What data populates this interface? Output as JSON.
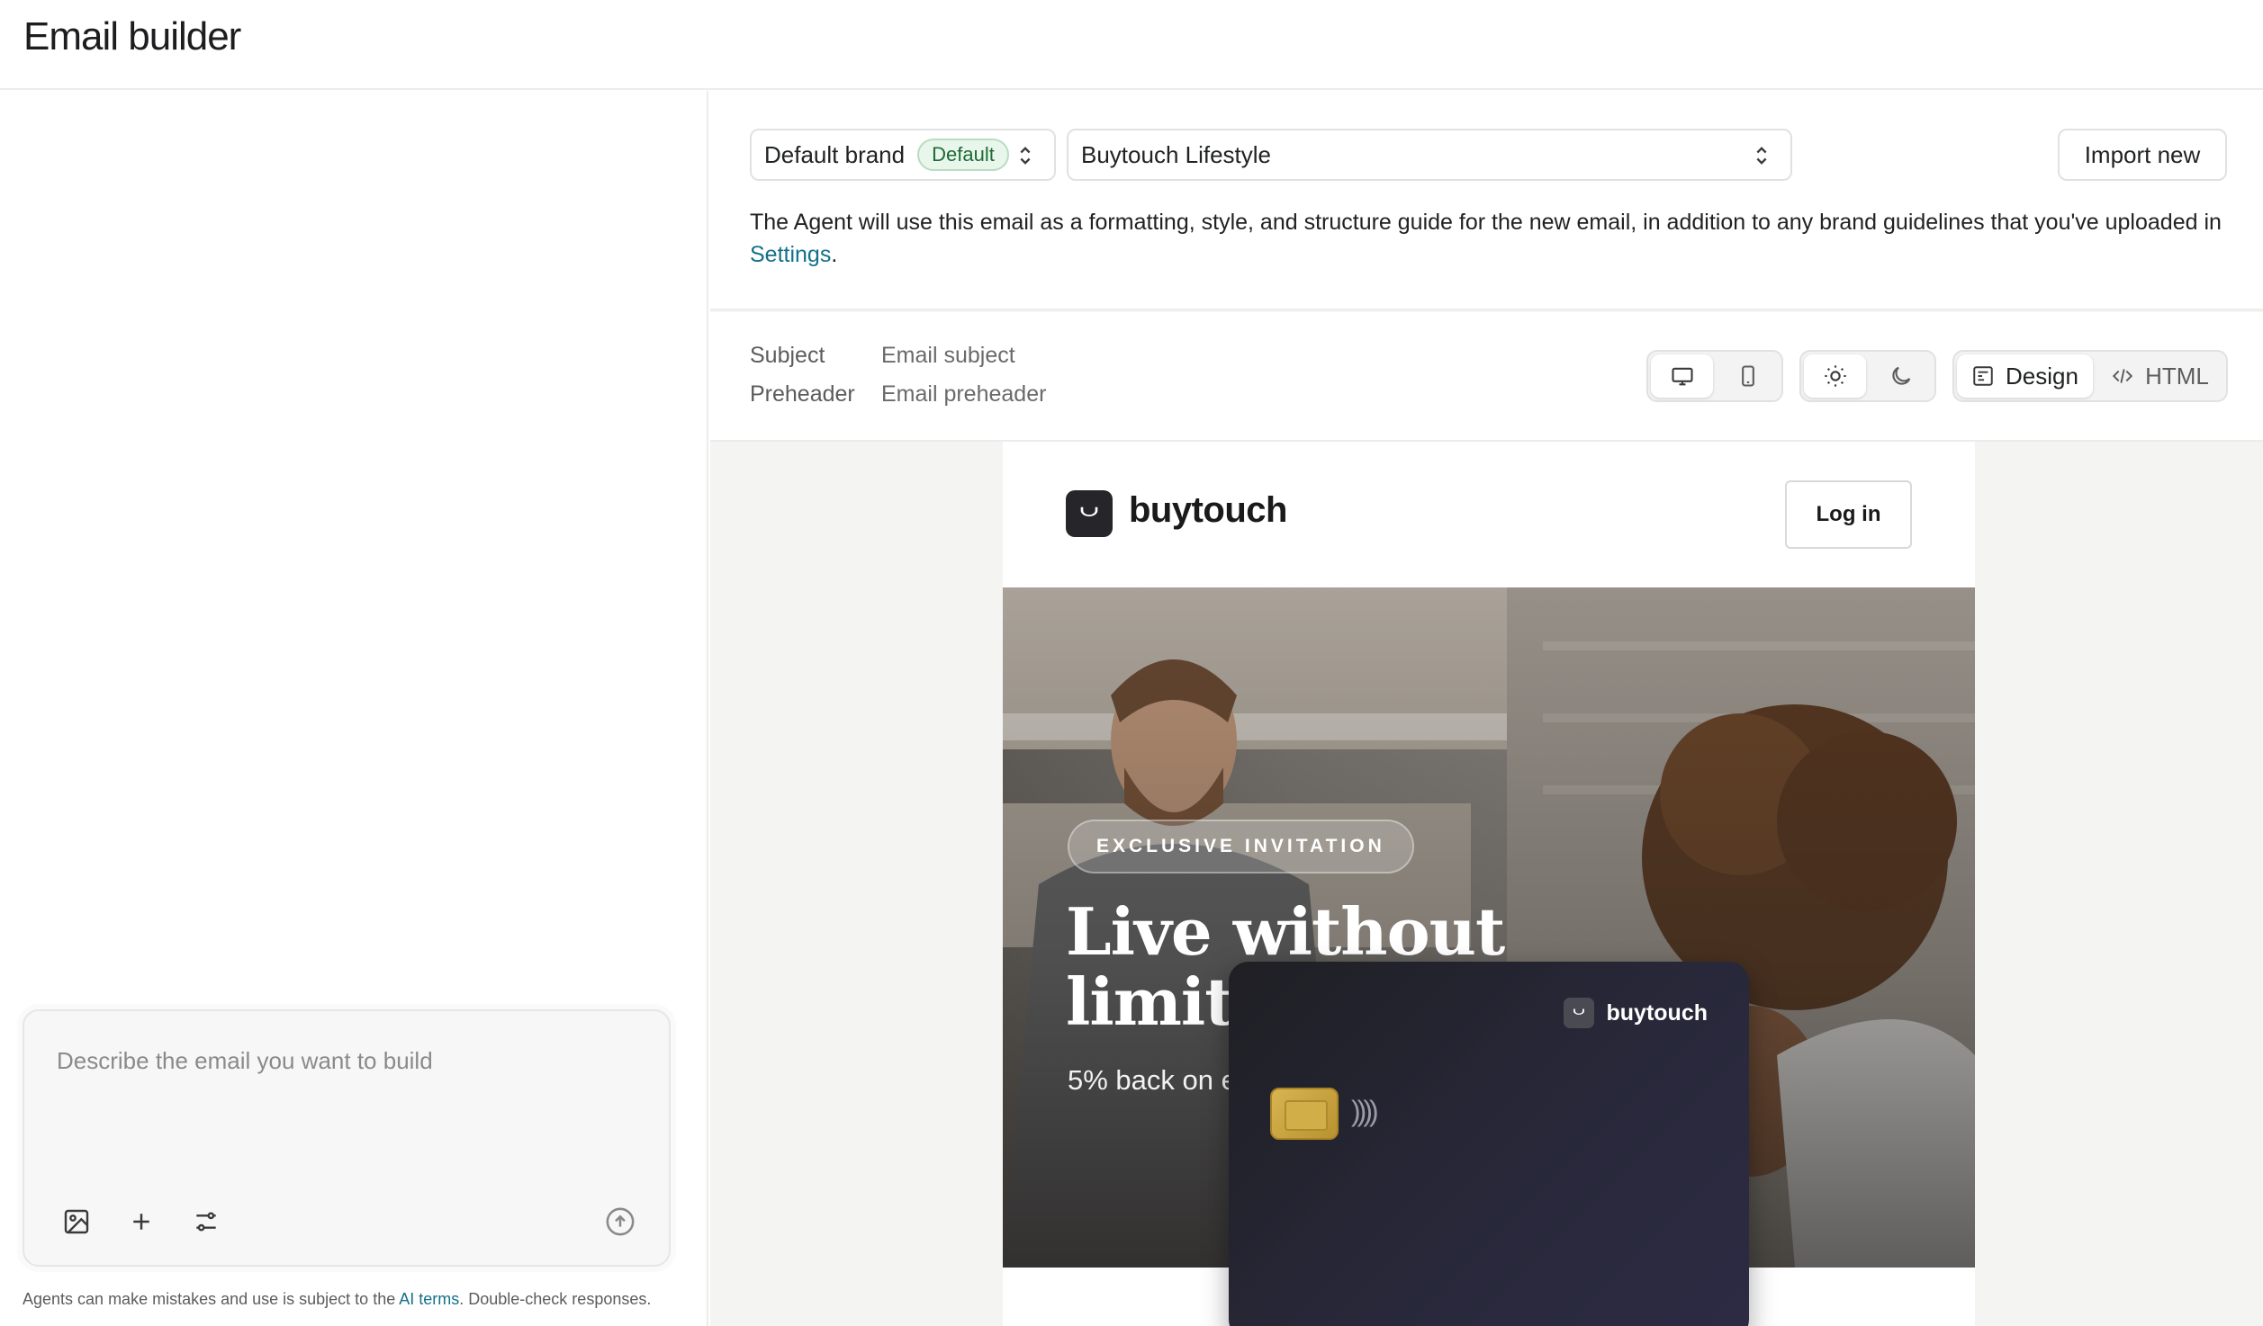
{
  "page": {
    "title": "Email builder"
  },
  "composer": {
    "placeholder": "Describe the email you want to build",
    "disclaimer_pre": "Agents can make mistakes and use is subject to the ",
    "disclaimer_link": "AI terms",
    "disclaimer_post": ". Double-check responses."
  },
  "config": {
    "brand_select": "Default brand",
    "brand_badge": "Default",
    "template_select": "Buytouch Lifestyle",
    "import_label": "Import new",
    "help_text": "The Agent will use this email as a formatting, style, and structure guide for the new email, in addition to any brand guidelines that you've uploaded in ",
    "help_link": "Settings",
    "help_end": "."
  },
  "meta": {
    "subject_label": "Subject",
    "subject_value": "Email subject",
    "preheader_label": "Preheader",
    "preheader_value": "Email preheader"
  },
  "view_toggles": {
    "device": [
      "desktop-icon",
      "mobile-icon"
    ],
    "device_active": "desktop",
    "theme": [
      "sun-icon",
      "moon-icon"
    ],
    "theme_active": "light",
    "mode_design": "Design",
    "mode_html": "HTML",
    "mode_active": "design"
  },
  "email": {
    "logo_text": "buytouch",
    "login_label": "Log in",
    "pill": "EXCLUSIVE INVITATION",
    "headline": "Live without limits.",
    "subline": "5% back on every. single. purchase.",
    "card_logo": "buytouch",
    "contactless": "))))"
  },
  "colors": {
    "link": "#13708a",
    "badge_bg": "#e9f6ec",
    "badge_text": "#1e6b35",
    "card_bg": "#26263a",
    "chip": "#d2ae48"
  }
}
